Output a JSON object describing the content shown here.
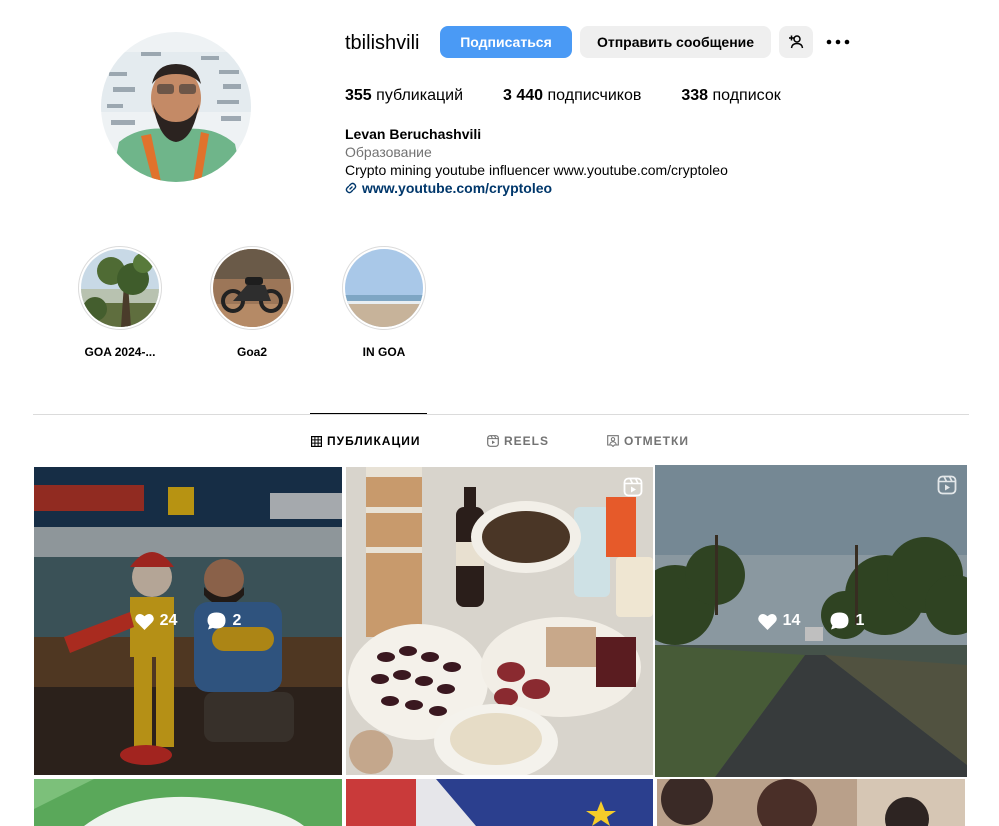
{
  "profile": {
    "username": "tbilishvili",
    "follow_label": "Подписаться",
    "message_label": "Отправить сообщение",
    "posts_count": "355",
    "posts_label": "публикаций",
    "followers_count": "3 440",
    "followers_label": "подписчиков",
    "following_count": "338",
    "following_label": "подписок",
    "full_name": "Levan Beruchashvili",
    "category": "Образование",
    "bio": "Crypto mining youtube influencer www.youtube.com/cryptoleo",
    "link": "www.youtube.com/cryptoleo"
  },
  "highlights": [
    {
      "label": "GOA 2024-..."
    },
    {
      "label": "Goa2"
    },
    {
      "label": "IN GOA"
    }
  ],
  "tabs": [
    {
      "label": "ПУБЛИКАЦИИ",
      "active": true
    },
    {
      "label": "REELS",
      "active": false
    },
    {
      "label": "ОТМЕТКИ",
      "active": false
    }
  ],
  "posts": [
    {
      "likes": "24",
      "comments": "2",
      "is_reel": false
    },
    {
      "likes": "",
      "comments": "",
      "is_reel": true
    },
    {
      "likes": "14",
      "comments": "1",
      "is_reel": true
    }
  ],
  "colors": {
    "follow_button": "#4a9af5",
    "secondary_button": "#efefef",
    "link": "#00376b",
    "muted_text": "#737373",
    "divider": "#dbdbdb",
    "hover_outline": "#9ed08e"
  }
}
